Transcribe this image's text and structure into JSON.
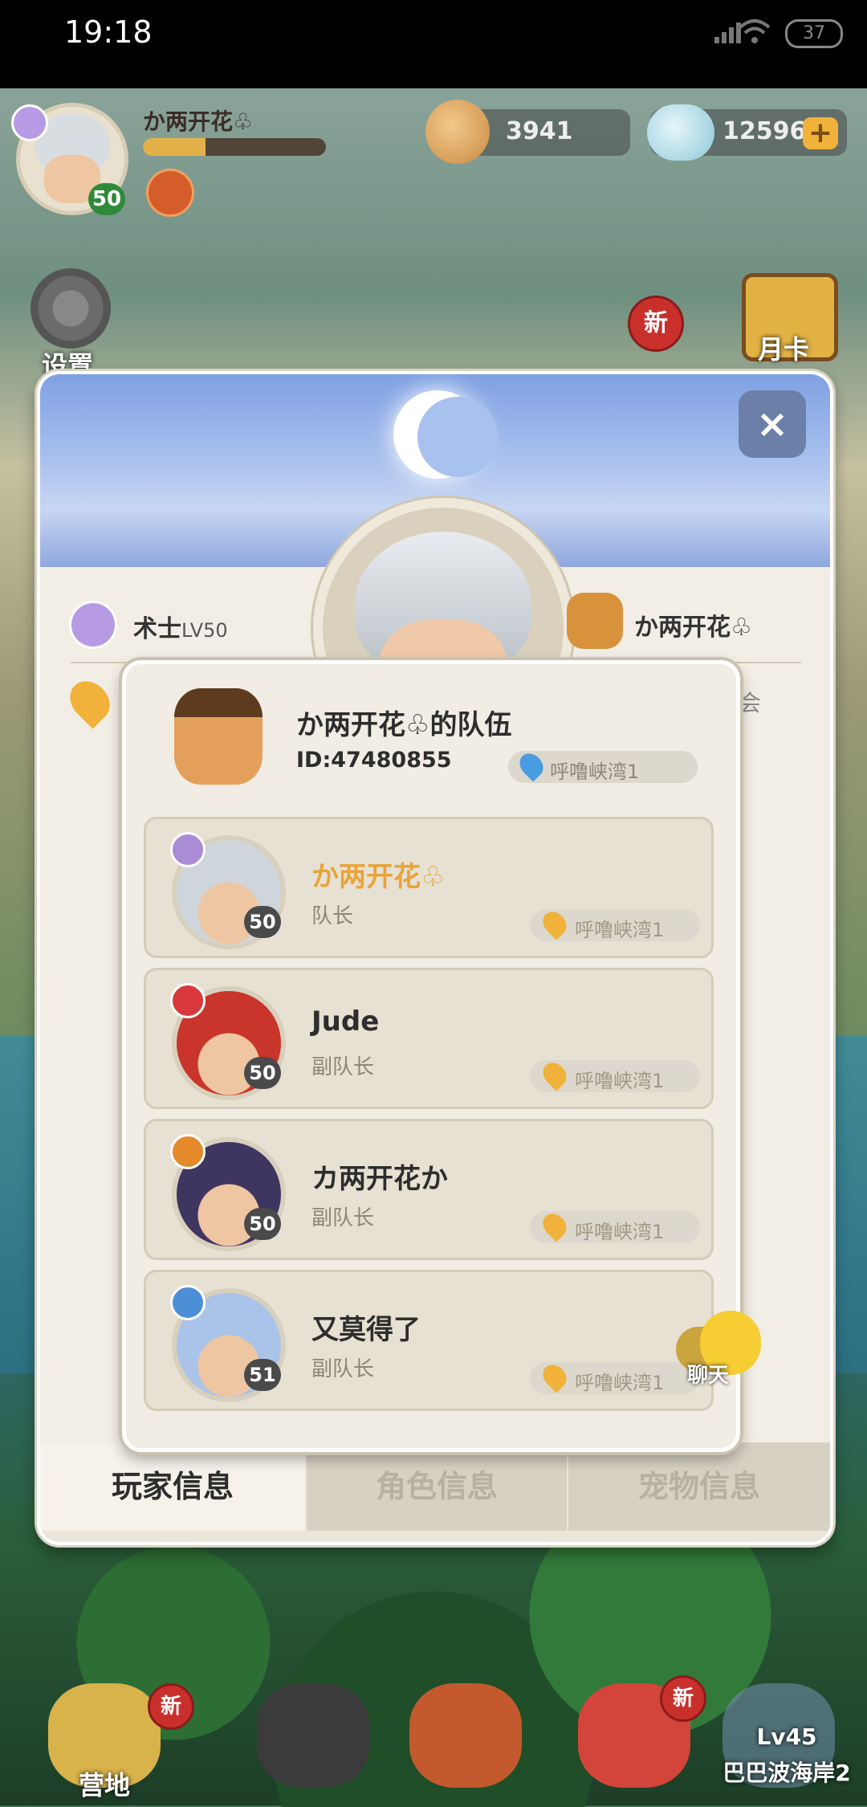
{
  "status_bar": {
    "time": "19:18",
    "battery": "37"
  },
  "hud": {
    "player_name": "か两开花♧",
    "level": "50",
    "exp_progress": 0.34,
    "currency1": "3941",
    "currency2": "12596",
    "plus": "+",
    "settings_label": "设置",
    "month_card_label": "月卡",
    "new_badge": "新"
  },
  "panel": {
    "close": "×",
    "class_name": "术士",
    "class_level": "LV50",
    "team_name_header": "か两开花♧",
    "hint_tail": "会",
    "tabs": [
      {
        "label": "玩家信息",
        "active": true
      },
      {
        "label": "角色信息",
        "active": false
      },
      {
        "label": "宠物信息",
        "active": false
      }
    ]
  },
  "team": {
    "title": "か两开花♧的队伍",
    "id": "ID:47480855",
    "location": "呼噜峡湾1",
    "members": [
      {
        "name": "か两开花♧",
        "role": "队长",
        "level": "50",
        "location": "呼噜峡湾1",
        "class_color": "#a98bd6",
        "avatar_color": "#cfd6db",
        "leader": true
      },
      {
        "name": "Jude",
        "role": "副队长",
        "level": "50",
        "location": "呼噜峡湾1",
        "class_color": "#d9393c",
        "avatar_color": "#c9342b",
        "leader": false
      },
      {
        "name": "カ两开花か",
        "role": "副队长",
        "level": "50",
        "location": "呼噜峡湾1",
        "class_color": "#e48a2a",
        "avatar_color": "#3e3560",
        "leader": false
      },
      {
        "name": "又莫得了",
        "role": "副队长",
        "level": "51",
        "location": "呼噜峡湾1",
        "class_color": "#4d8fd6",
        "avatar_color": "#a9c4e8",
        "leader": false
      }
    ]
  },
  "chat_label": "聊天",
  "bottom_nav": {
    "camp_label": "营地",
    "new_badge": "新",
    "locked_level": "Lv45",
    "locked_name": "巴巴波海岸2"
  }
}
